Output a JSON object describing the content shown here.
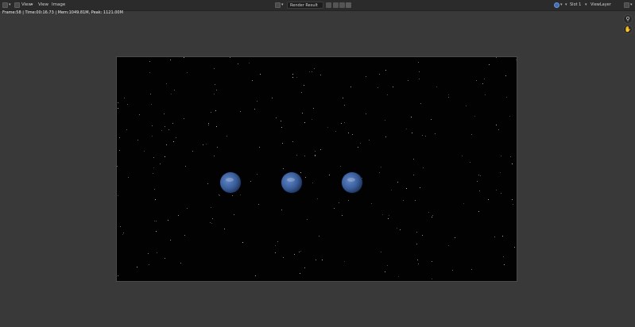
{
  "header": {
    "editor_type_icon": "image-editor-icon",
    "menus": [
      "View",
      "View",
      "Image"
    ],
    "image_browse_icon": "image-browse-icon",
    "image_name": "Render Result",
    "image_actions": [
      "fake-user-icon",
      "new-image-icon",
      "open-image-icon",
      "unlink-icon"
    ],
    "display_mode_icon": "display-mode-icon",
    "slot": "Slot 1",
    "view_layer": "ViewLayer",
    "render_pass_icon": "render-pass-icon"
  },
  "stats": {
    "text": "Frame:58 | Time:00:16.73 | Mem:1049.81M, Peak: 1121.00M"
  },
  "viewport_tools": [
    "zoom-icon",
    "pan-hand-icon"
  ],
  "colors": {
    "editor_bg": "#393939",
    "header_bg": "#2b2b2b",
    "render_bg": "#020203",
    "planet": "#3b5f9c"
  }
}
